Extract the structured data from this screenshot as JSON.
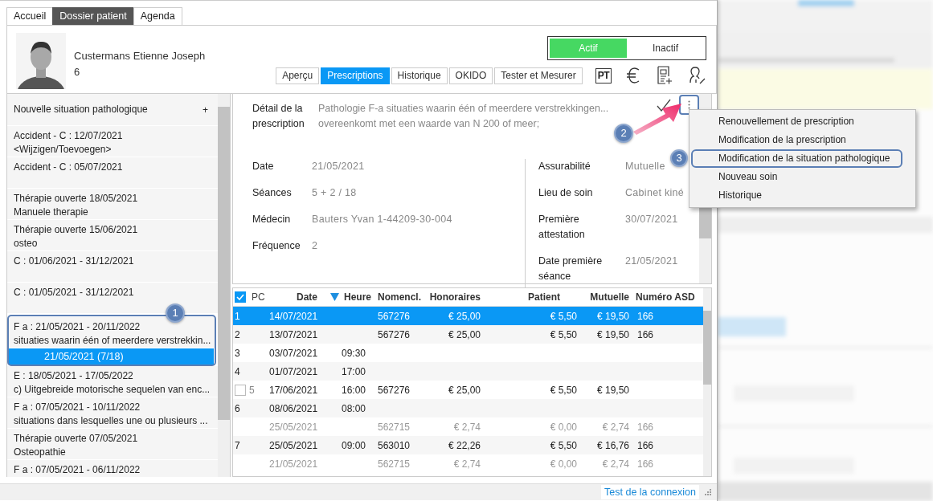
{
  "main_tabs": [
    {
      "label": "Accueil",
      "selected": false
    },
    {
      "label": "Dossier patient",
      "selected": true
    },
    {
      "label": "Agenda",
      "selected": false
    }
  ],
  "patient": {
    "name": "Custermans Etienne Joseph",
    "number": "6"
  },
  "status_toggle": [
    {
      "label": "Actif",
      "selected": true
    },
    {
      "label": "Inactif",
      "selected": false
    }
  ],
  "tabs": [
    {
      "label": "Aperçu",
      "selected": false
    },
    {
      "label": "Prescriptions",
      "selected": true
    },
    {
      "label": "Historique",
      "selected": false
    },
    {
      "label": "OKIDO",
      "selected": false
    },
    {
      "label": "Tester et Mesurer",
      "selected": false
    }
  ],
  "toolbar": [
    {
      "kind": "badge",
      "label": "PT"
    },
    {
      "kind": "euro"
    },
    {
      "kind": "document"
    },
    {
      "kind": "user"
    }
  ],
  "situations": {
    "new_item": {
      "label": "Nouvelle situation pathologique",
      "action": "+"
    },
    "items": [
      {
        "lines": [
          "Accident - C : 12/07/2021",
          "<Wijzigen/Toevoegen>"
        ]
      },
      {
        "lines": [
          "Accident - C : 05/07/2021"
        ]
      },
      {
        "lines": [
          "Thérapie ouverte 18/05/2021",
          "Manuele therapie"
        ]
      },
      {
        "lines": [
          "Thérapie ouverte 15/06/2021",
          "osteo"
        ]
      },
      {
        "lines": [
          "C : 01/06/2021 - 31/12/2021"
        ]
      },
      {
        "lines": [
          "C : 01/05/2021 - 31/12/2021"
        ]
      },
      {
        "lines": [
          "F a : 21/05/2021 - 20/11/2022",
          "situaties waarin één of meerdere verstrekkin..."
        ],
        "children": [
          {
            "label": "21/05/2021  (7/18)",
            "selected": true
          }
        ]
      },
      {
        "lines": [
          "E : 18/05/2021 - 17/05/2022",
          "c) Uitgebreide motorische sequelen van enc..."
        ]
      },
      {
        "lines": [
          "F a : 07/05/2021 - 10/11/2022",
          "situations dans lesquelles une ou plusieurs ..."
        ]
      },
      {
        "lines": [
          "Thérapie ouverte 07/05/2021",
          "Osteopathie"
        ]
      },
      {
        "lines": [
          "F a : 07/05/2021 - 06/11/2022"
        ]
      }
    ]
  },
  "detail": {
    "label": "Détail de la prescription",
    "lines": [
      "Pathologie F-a situaties waarin één of meerdere verstrekkingen...",
      "overeenkomt met een waarde van N 200 of meer;"
    ],
    "fields_left": [
      {
        "label": "Date",
        "value": "21/05/2021"
      },
      {
        "label": "Séances",
        "value": "5 + 2 / 18"
      },
      {
        "label": "Médecin",
        "value": "Bauters Yvan 1-44209-30-004"
      },
      {
        "label": "Fréquence",
        "value": "2"
      }
    ],
    "fields_right": [
      {
        "label": "Assurabilité",
        "value": "Mutuelle"
      },
      {
        "label": "Lieu de soin",
        "value": "Cabinet kiné"
      },
      {
        "label": "Première attestation",
        "value": "30/07/2021"
      },
      {
        "label": "Date première séance",
        "value": "21/05/2021"
      }
    ]
  },
  "menu": {
    "items": [
      {
        "label": "Renouvellement de prescription",
        "highlighted": false
      },
      {
        "label": "Modification de la prescription",
        "highlighted": false
      },
      {
        "label": "Modification de la situation pathologique",
        "highlighted": true
      },
      {
        "label": "Nouveau soin",
        "highlighted": false
      },
      {
        "label": "Historique",
        "highlighted": false
      }
    ]
  },
  "table": {
    "select_all_checked": true,
    "columns": [
      {
        "label": "PC",
        "sorted": false
      },
      {
        "label": "Date",
        "sorted": true
      },
      {
        "label": "Heure",
        "sorted": false
      },
      {
        "label": "Nomencl.",
        "sorted": false
      },
      {
        "label": "Honoraires",
        "sorted": false
      },
      {
        "label": "Patient",
        "sorted": false
      },
      {
        "label": "Mutuelle",
        "sorted": false
      },
      {
        "label": "Numéro ASD",
        "sorted": false
      }
    ],
    "rows": [
      {
        "kind": "plain",
        "number": "1",
        "date": "14/07/2021",
        "nomencl": "567276",
        "fees": "€ 25,00",
        "patient": "€ 5,50",
        "mutual": "€ 19,50",
        "asd": "166",
        "selected": true,
        "muted": false
      },
      {
        "kind": "plain",
        "number": "2",
        "date": "13/07/2021",
        "nomencl": "567276",
        "fees": "€ 25,00",
        "patient": "€ 5,50",
        "mutual": "€ 19,50",
        "asd": "166",
        "selected": false,
        "muted": false
      },
      {
        "kind": "plain",
        "number": "3",
        "date": "03/07/2021",
        "time": "09:30",
        "selected": false,
        "muted": false
      },
      {
        "kind": "plain",
        "number": "4",
        "date": "01/07/2021",
        "time": "17:00",
        "selected": false,
        "muted": false
      },
      {
        "kind": "checkbox",
        "checked": false,
        "number": "5",
        "date": "17/06/2021",
        "time": "16:00",
        "nomencl": "567276",
        "fees": "€ 25,00",
        "patient": "€ 5,50",
        "mutual": "€ 19,50",
        "selected": false,
        "muted": false
      },
      {
        "kind": "plain",
        "number": "6",
        "date": "08/06/2021",
        "time": "08:00",
        "selected": false,
        "muted": false
      },
      {
        "kind": "plain",
        "date": "25/05/2021",
        "nomencl": "562715",
        "fees": "€ 2,74",
        "patient": "€ 0,00",
        "mutual": "€ 2,74",
        "asd": "166",
        "selected": false,
        "muted": true
      },
      {
        "kind": "plain",
        "number": "7",
        "date": "25/05/2021",
        "time": "09:00",
        "nomencl": "563010",
        "fees": "€ 22,26",
        "patient": "€ 5,50",
        "mutual": "€ 16,76",
        "asd": "166",
        "selected": false,
        "muted": false
      },
      {
        "kind": "plain",
        "date": "21/05/2021",
        "nomencl": "562715",
        "fees": "€ 2,74",
        "patient": "€ 0,00",
        "mutual": "€ 2,74",
        "asd": "166",
        "selected": false,
        "muted": true
      }
    ]
  },
  "status_bar": {
    "link": "Test de la connexion"
  },
  "annotations": [
    {
      "label": "1"
    },
    {
      "label": "2"
    },
    {
      "label": "3"
    }
  ]
}
